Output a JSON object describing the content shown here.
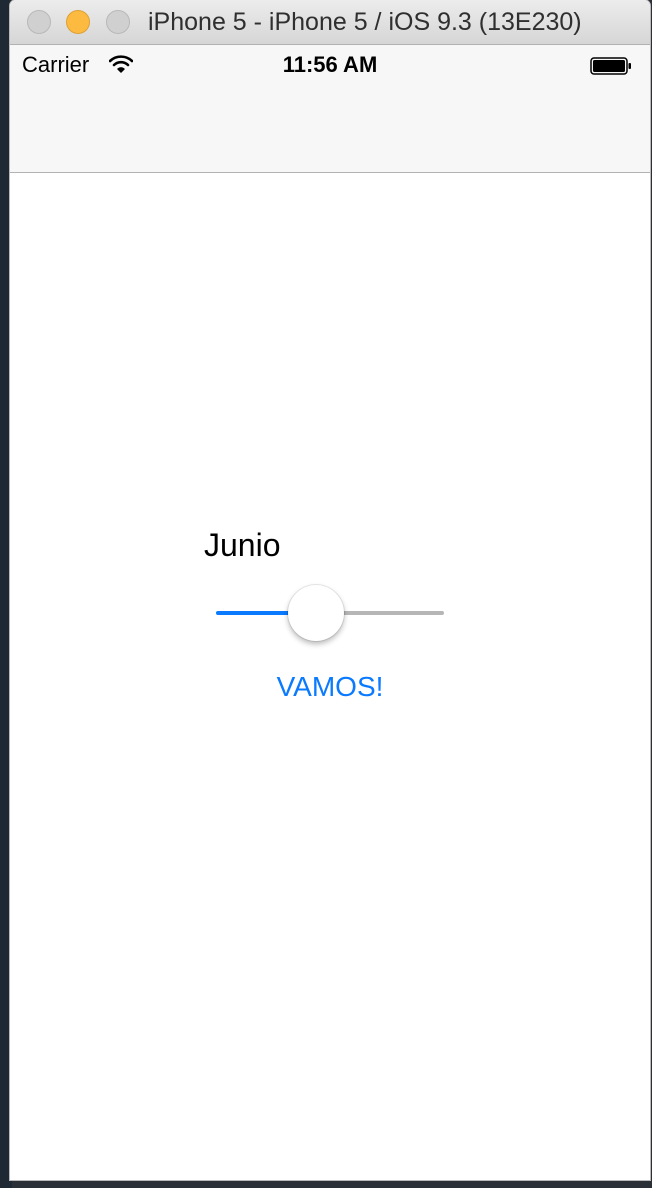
{
  "window": {
    "title": "iPhone 5 - iPhone 5 / iOS 9.3 (13E230)"
  },
  "status_bar": {
    "carrier": "Carrier",
    "time": "11:56 AM",
    "icons": [
      "wifi-icon",
      "battery-icon"
    ]
  },
  "main": {
    "month_label": "Junio",
    "slider": {
      "value": 0.44,
      "min_track_color": "#0a7aff",
      "max_track_color": "#b6b6b6"
    },
    "action_button": "VAMOS!"
  },
  "colors": {
    "accent": "#0a7aff",
    "traffic_minimize": "#fcbb40"
  }
}
